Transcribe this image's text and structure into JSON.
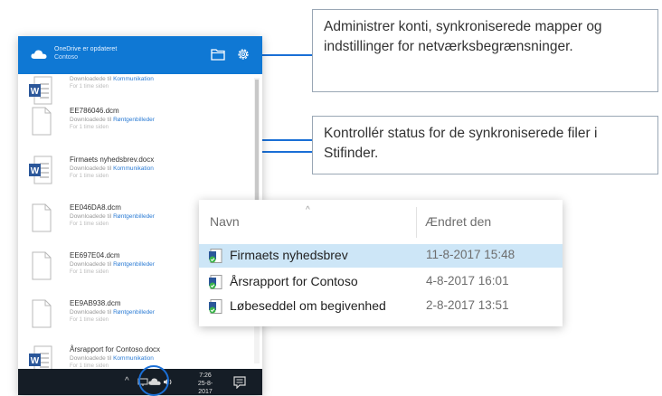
{
  "onedrive": {
    "header": {
      "title": "OneDrive er opdateret",
      "subtitle": "Contoso",
      "folder_icon": "folder-icon",
      "settings_icon": "gear-icon",
      "color": "#0f78d4"
    },
    "files": [
      {
        "name": "",
        "status_prefix": "Downloadede til",
        "location": "Kommunikation",
        "time": "For 1 time siden",
        "icon": "word-icon"
      },
      {
        "name": "EE786046.dcm",
        "status_prefix": "Downloadede til",
        "location": "Røntgenbilleder",
        "time": "For 1 time siden",
        "icon": "file-icon"
      },
      {
        "name": "Firmaets nyhedsbrev.docx",
        "status_prefix": "Downloadede til",
        "location": "Kommunikation",
        "time": "For 1 time siden",
        "icon": "word-icon"
      },
      {
        "name": "EE046DA8.dcm",
        "status_prefix": "Downloadede til",
        "location": "Røntgenbilleder",
        "time": "For 1 time siden",
        "icon": "file-icon"
      },
      {
        "name": "EE697E04.dcm",
        "status_prefix": "Downloadede til",
        "location": "Røntgenbilleder",
        "time": "For 1 time siden",
        "icon": "file-icon"
      },
      {
        "name": "EE9AB938.dcm",
        "status_prefix": "Downloadede til",
        "location": "Røntgenbilleder",
        "time": "For 1 time siden",
        "icon": "file-icon"
      },
      {
        "name": "Årsrapport for Contoso.docx",
        "status_prefix": "Downloadede til",
        "location": "Kommunikation",
        "time": "For 1 time siden",
        "icon": "word-icon"
      }
    ]
  },
  "taskbar": {
    "time": "7:26",
    "date": "25-8-2017"
  },
  "callouts": {
    "top": "Administrer konti, synkroniserede mapper og indstillinger for netværksbegrænsninger.",
    "middle": "Kontrollér status for de synkroniserede filer i Stifinder."
  },
  "explorer": {
    "columns": {
      "name": "Navn",
      "modified": "Ændret den"
    },
    "rows": [
      {
        "name": "Firmaets nyhedsbrev",
        "date": "11-8-2017 15:48",
        "selected": true
      },
      {
        "name": "Årsrapport for Contoso",
        "date": "4-8-2017 16:01",
        "selected": false
      },
      {
        "name": "Løbeseddel om begivenhed",
        "date": "2-8-2017 13:51",
        "selected": false
      }
    ]
  },
  "colors": {
    "accent": "#0f78d4",
    "callout_line": "#1a6fd6",
    "selected_row": "#cde6f7"
  }
}
